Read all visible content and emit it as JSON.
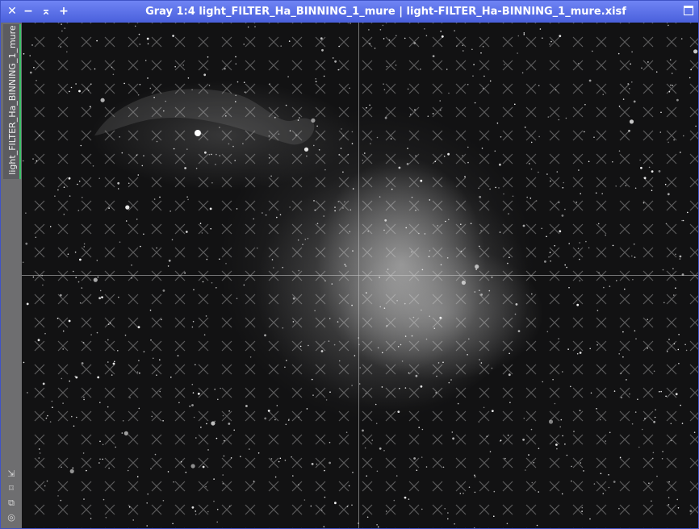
{
  "window": {
    "title": "Gray 1:4 light_FILTER_Ha_BINNING_1_mure | light-FILTER_Ha-BINNING_1_mure.xisf",
    "close_glyph": "✕",
    "shade_glyph": "−",
    "fit_glyph": "⌅",
    "zoom_in_glyph": "+"
  },
  "sidebar": {
    "tab_label": "light_FILTER_Ha_BINNING_1_mure",
    "icons": [
      "shrink-icon",
      "fit-view-icon",
      "clone-icon",
      "mask-icon"
    ]
  },
  "colors": {
    "titlebar": "#5a6fe8",
    "sidebar": "#6e6e70",
    "tab_indicator": "#3bc46a",
    "image_background": "#121213"
  }
}
